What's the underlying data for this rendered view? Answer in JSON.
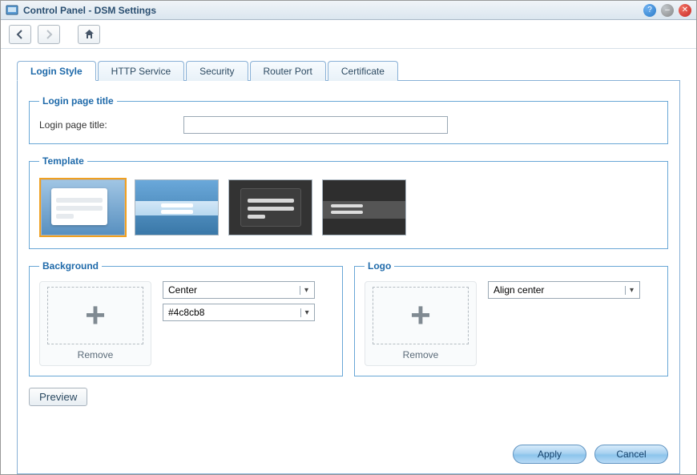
{
  "window": {
    "title": "Control Panel - DSM Settings"
  },
  "tabs": [
    "Login Style",
    "HTTP Service",
    "Security",
    "Router Port",
    "Certificate"
  ],
  "sections": {
    "login_title": {
      "legend": "Login page title",
      "label": "Login page title:",
      "value": ""
    },
    "template": {
      "legend": "Template"
    },
    "background": {
      "legend": "Background",
      "remove": "Remove",
      "position": "Center",
      "color": "#4c8cb8"
    },
    "logo": {
      "legend": "Logo",
      "remove": "Remove",
      "align": "Align center"
    }
  },
  "buttons": {
    "preview": "Preview",
    "apply": "Apply",
    "cancel": "Cancel"
  }
}
